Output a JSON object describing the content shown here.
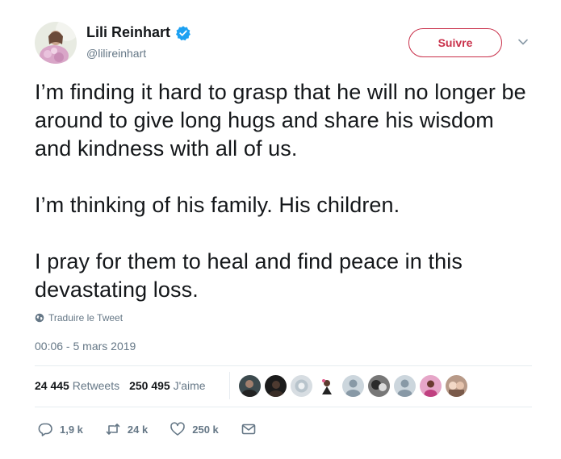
{
  "author": {
    "name": "Lili Reinhart",
    "handle": "@lilireinhart",
    "verified": true
  },
  "follow_button": {
    "label": "Suivre",
    "color": "#c9304a"
  },
  "tweet": {
    "paragraphs": [
      "I’m finding it hard to grasp that he will no longer be around to give long hugs and share his wisdom and kindness with all of us.",
      "I’m thinking of his family. His children.",
      "I pray for them to heal and find peace in this devastating loss."
    ],
    "translate_label": "Traduire le Tweet",
    "timestamp": "00:06 - 5 mars 2019"
  },
  "stats": {
    "retweets_count": "24 445",
    "retweets_label": "Retweets",
    "likes_count": "250 495",
    "likes_label": "J'aime"
  },
  "actions": {
    "replies": "1,9 k",
    "retweets": "24 k",
    "likes": "250 k"
  },
  "icons": [
    "verified-badge-icon",
    "chevron-down-icon",
    "globe-icon",
    "reply-icon",
    "retweet-icon",
    "heart-icon",
    "mail-icon"
  ],
  "colors": {
    "verified": "#1da1f2",
    "muted": "#657786",
    "text": "#14171a"
  }
}
